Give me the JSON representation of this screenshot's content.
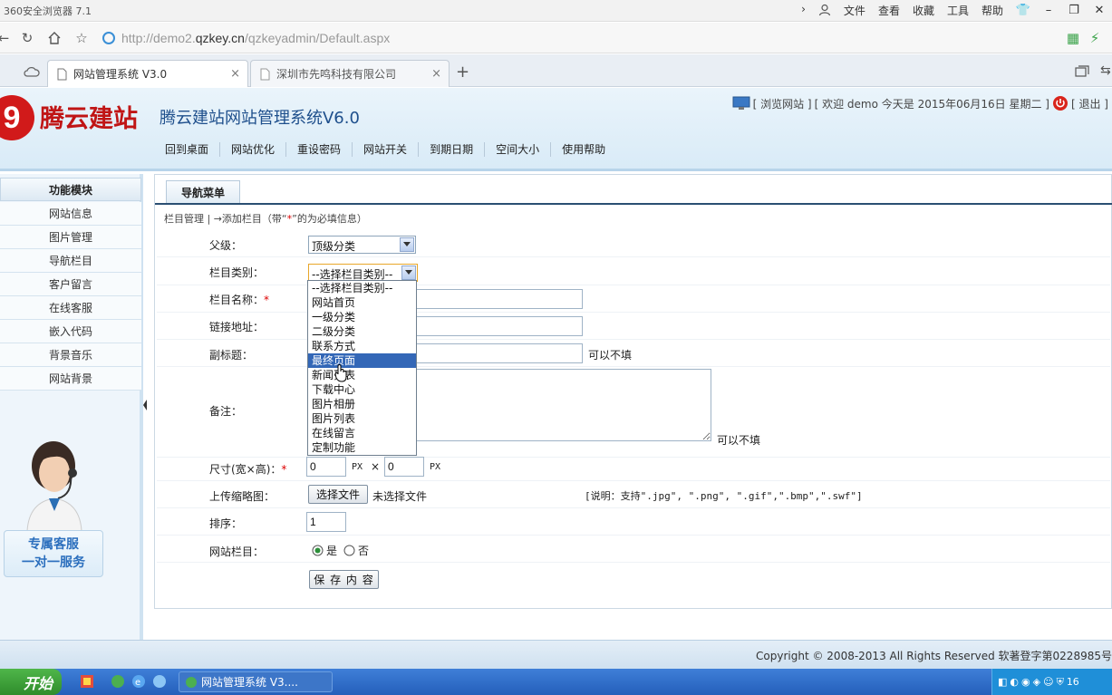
{
  "browser": {
    "app_name": "360安全浏览器 7.1",
    "menus": [
      "文件",
      "查看",
      "收藏",
      "工具",
      "帮助"
    ],
    "url_prefix": "http://demo2.",
    "url_host": "qzkey.cn",
    "url_path": "/qzkeyadmin/Default.aspx",
    "tabs": [
      {
        "label": "网站管理系统 V3.0",
        "close": "×"
      },
      {
        "label": "深圳市先鸣科技有限公司",
        "close": "×"
      }
    ],
    "new_tab": "+"
  },
  "header": {
    "logo_mark": "9",
    "logo_text": "腾云建站",
    "system_title": "腾云建站网站管理系统V6.0",
    "welcome_browse": "[ 浏览网站 ]",
    "welcome_text": "[ 欢迎 demo 今天是 2015年06月16日 星期二 ]",
    "logout_label": "[ 退出 ]",
    "nav": [
      "回到桌面",
      "网站优化",
      "重设密码",
      "网站开关",
      "到期日期",
      "空间大小",
      "使用帮助"
    ]
  },
  "sidebar": {
    "title": "功能模块",
    "items": [
      "网站信息",
      "图片管理",
      "导航栏目",
      "客户留言",
      "在线客服",
      "嵌入代码",
      "背景音乐",
      "网站背景"
    ],
    "service_line1": "专属客服",
    "service_line2": "一对一服务"
  },
  "main": {
    "tab_label": "导航菜单",
    "crumb_prefix": "栏目管理 | →添加栏目（带“",
    "crumb_star": "*",
    "crumb_suffix": "”的为必填信息）",
    "form": {
      "parent_label": "父级：",
      "parent_value": "顶级分类",
      "category_label": "栏目类别：",
      "category_value": "--选择栏目类别--",
      "name_label": "栏目名称：",
      "link_label": "链接地址：",
      "subtitle_label": "副标题：",
      "subtitle_hint": "可以不填",
      "remark_label": "备注：",
      "remark_hint": "可以不填",
      "size_label": "尺寸(宽×高)：",
      "width_value": "0",
      "height_value": "0",
      "px_unit": "PX",
      "times": "×",
      "thumb_label": "上传缩略图：",
      "choose_file": "选择文件",
      "no_file": "未选择文件",
      "file_note": "[说明：支持\".jpg\", \".png\", \".gif\",\".bmp\",\".swf\"]",
      "order_label": "排序：",
      "order_value": "1",
      "site_col_label": "网站栏目：",
      "yes_label": "是",
      "no_label": "否",
      "save_button": "保 存 内 容",
      "required_mark": "*"
    },
    "category_options": [
      "--选择栏目类别--",
      "网站首页",
      "一级分类",
      "二级分类",
      "联系方式",
      "最终页面",
      "新闻列表",
      "下载中心",
      "图片相册",
      "图片列表",
      "在线留言",
      "定制功能"
    ],
    "category_highlighted_index": 5
  },
  "footer": {
    "copyright": "Copyright © 2008-2013 All Rights Reserved 软著登字第0228985号"
  },
  "taskbar": {
    "start_label": "开始",
    "app_label": "网站管理系统 V3....",
    "clock": "16"
  },
  "colors": {
    "brand_red": "#c01515",
    "title_blue": "#1e4f8c",
    "highlight": "#3367b7",
    "taskbar": "#245fba"
  }
}
